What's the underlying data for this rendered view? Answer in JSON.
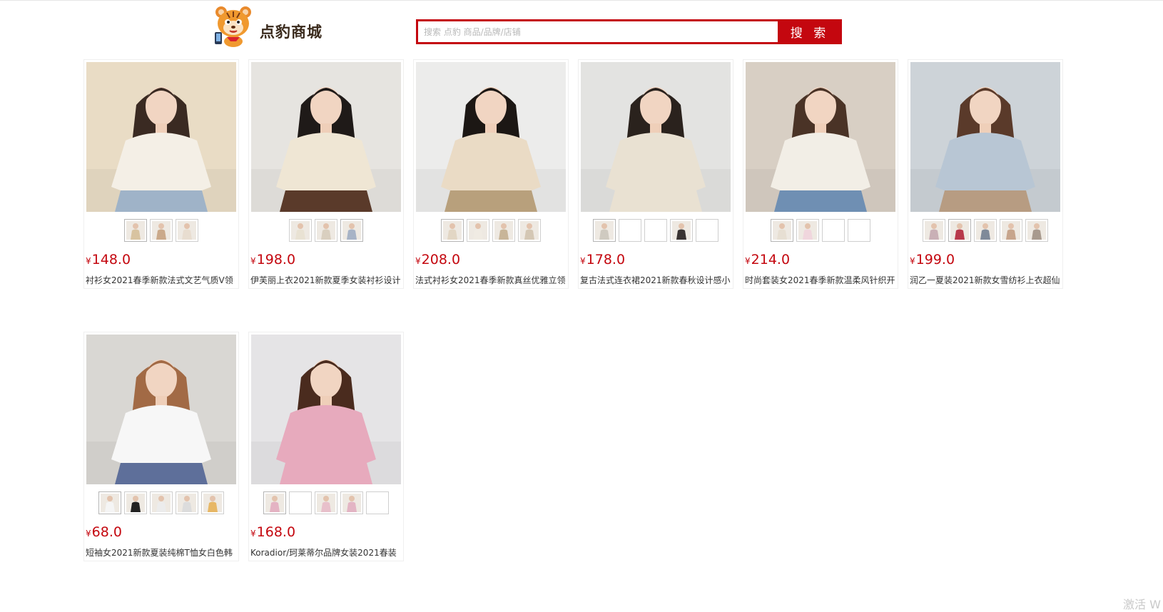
{
  "header": {
    "logo_text": "点豹商城",
    "search": {
      "placeholder": "搜索 点豹 商品/品牌/店铺",
      "value": "",
      "button_label": "搜 索"
    }
  },
  "currency_symbol": "¥",
  "products": [
    {
      "price": "148.0",
      "title": "衬衫女2021春季新款法式文艺气质V领",
      "bg": "#e9dcc5",
      "figure": "#f4efe6",
      "hair": "#3a2a22",
      "skirt": "#9fb3c8",
      "thumbs": [
        "#d8c3a0",
        "#caa98a",
        "#e8ddd0"
      ],
      "selected_thumb": 0
    },
    {
      "price": "198.0",
      "title": "伊芙丽上衣2021新款夏季女装衬衫设计",
      "bg": "#e6e4e0",
      "figure": "#efe6d4",
      "hair": "#1f1a18",
      "skirt": "#5a3a2a",
      "thumbs": [
        "#e9e2d3",
        "#d9cfbf",
        "#a7b3c6"
      ],
      "selected_thumb": 2
    },
    {
      "price": "208.0",
      "title": "法式衬衫女2021春季新款真丝优雅立领",
      "bg": "#ececeb",
      "figure": "#eadbc5",
      "hair": "#1c1714",
      "skirt": "#b8a07c",
      "thumbs": [
        "#e2d6c4",
        "#f0ebe3",
        "#c8b598",
        "#d4c7b4"
      ],
      "selected_thumb": 0
    },
    {
      "price": "178.0",
      "title": "复古法式连衣裙2021新款春秋设计感小",
      "bg": "#e3e3e1",
      "figure": "#e9e1d2",
      "hair": "#2a221d",
      "skirt": "#e9e1d2",
      "thumbs": [
        "#cfcac0",
        "#ffffff",
        "#ffffff",
        "#3a3432",
        "#ffffff"
      ],
      "selected_thumb": 0
    },
    {
      "price": "214.0",
      "title": "时尚套装女2021春季新款温柔风针织开",
      "bg": "#d8cfc4",
      "figure": "#f2eee6",
      "hair": "#4a3326",
      "skirt": "#6f8fb3",
      "thumbs": [
        "#e7dfd3",
        "#f0d6dd",
        "#ffffff",
        "#ffffff"
      ],
      "selected_thumb": 0
    },
    {
      "price": "199.0",
      "title": "润乙一夏装2021新款女雪纺衫上衣超仙",
      "bg": "#cdd3d8",
      "figure": "#b8c6d4",
      "hair": "#5a3a2a",
      "skirt": "#b79c82",
      "thumbs": [
        "#c9b0b6",
        "#b8394b",
        "#7f8a99",
        "#c7a58c",
        "#a89a8e"
      ],
      "selected_thumb": 1
    },
    {
      "price": "68.0",
      "title": "短袖女2021新款夏装纯棉T恤女白色韩",
      "bg": "#d9d7d3",
      "figure": "#f7f7f7",
      "hair": "#a26a45",
      "skirt": "#5e6f9a",
      "thumbs": [
        "#f5f5f5",
        "#222222",
        "#ececec",
        "#dcdcdc",
        "#e7b765"
      ],
      "selected_thumb": 0
    },
    {
      "price": "168.0",
      "title": "Koradior/珂莱蒂尔品牌女装2021春装",
      "bg": "#e5e4e6",
      "figure": "#e7aabd",
      "hair": "#4a2b1e",
      "skirt": "#e7aabd",
      "thumbs": [
        "#e4b3c3",
        "#ffffff",
        "#e8c0cb",
        "#e3b5c4",
        "#ffffff"
      ],
      "selected_thumb": 0
    }
  ],
  "colors": {
    "brand_red": "#c4070f",
    "price_red": "#c4070f"
  },
  "watermark_text": "激活 W"
}
